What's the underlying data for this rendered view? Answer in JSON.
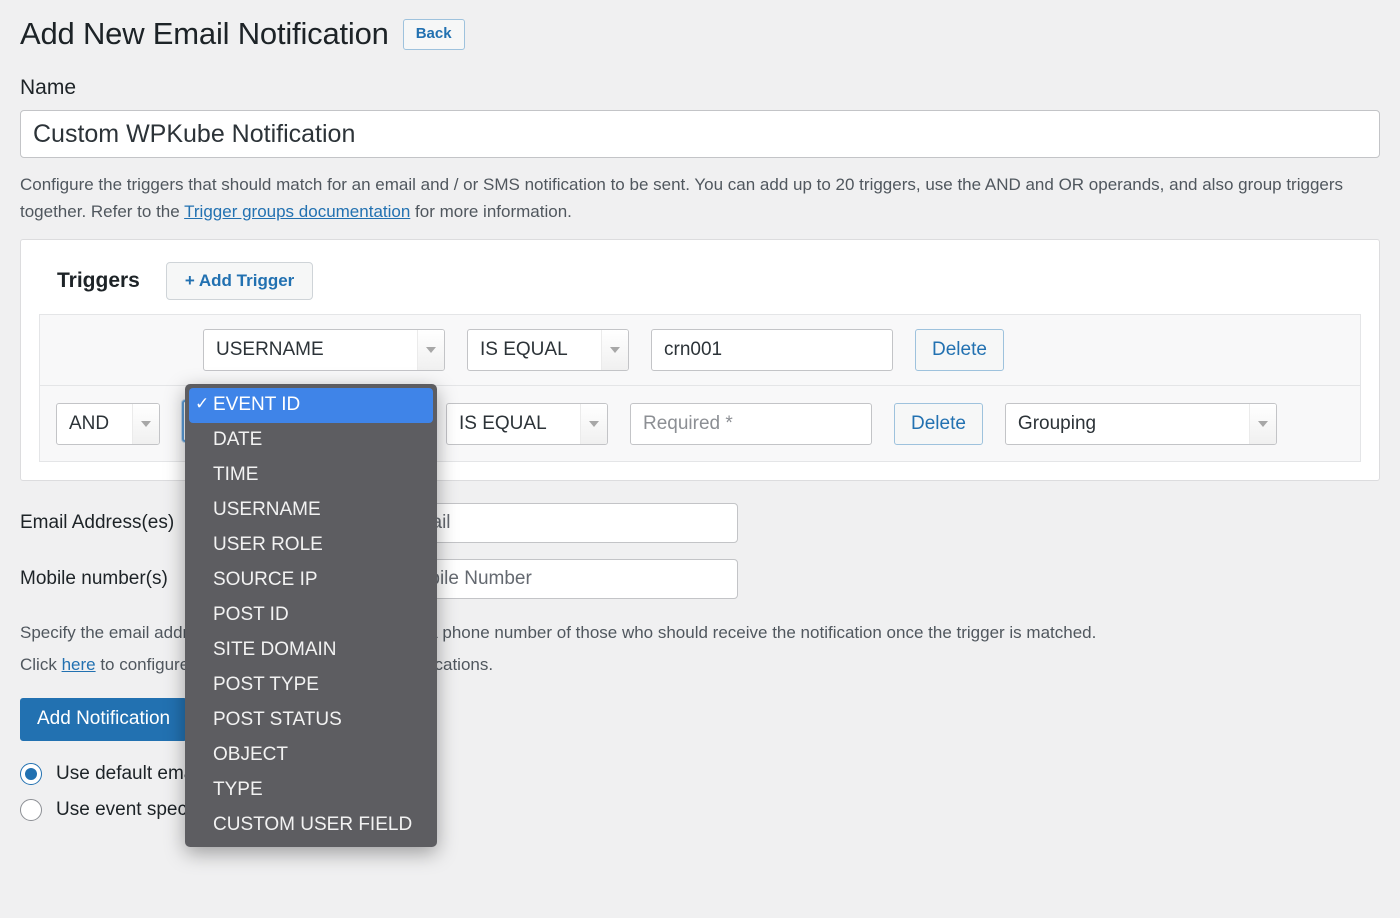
{
  "header": {
    "title": "Add New Email Notification",
    "back_label": "Back"
  },
  "name_section": {
    "label": "Name",
    "value": "Custom WPKube Notification"
  },
  "description": {
    "part1": "Configure the triggers that should match for an email and / or SMS notification to be sent. You can add up to 20 triggers, use the AND and OR operands, and also group triggers together. Refer to the ",
    "link": "Trigger groups documentation",
    "part2": " for more information."
  },
  "triggers": {
    "title": "Triggers",
    "add_label": "+ Add Trigger",
    "rows": [
      {
        "operand": "",
        "field": "USERNAME",
        "condition": "IS EQUAL",
        "value": "crn001",
        "value_placeholder": "",
        "delete_label": "Delete",
        "grouping": ""
      },
      {
        "operand": "AND",
        "field": "EVENT ID",
        "condition": "IS EQUAL",
        "value": "",
        "value_placeholder": "Required *",
        "delete_label": "Delete",
        "grouping": "Grouping"
      }
    ],
    "field_dropdown": {
      "selected": "EVENT ID",
      "options": [
        "EVENT ID",
        "DATE",
        "TIME",
        "USERNAME",
        "USER ROLE",
        "SOURCE IP",
        "POST ID",
        "SITE DOMAIN",
        "POST TYPE",
        "POST STATUS",
        "OBJECT",
        "TYPE",
        "CUSTOM USER FIELD"
      ]
    }
  },
  "recipients": {
    "email_label": "Email Address(es)",
    "email_placeholder": "Email",
    "email_value": "",
    "mobile_label": "Mobile number(s)",
    "mobile_placeholder": "Mobile Number",
    "mobile_value": ""
  },
  "notes": {
    "line1": "Specify the email address, a username, a user role or a phone number of those who should receive the notification once the trigger is matched.",
    "line2_before": "Click ",
    "line2_link": "here",
    "line2_after": " to configure the Twilio settings for SMS notifications."
  },
  "footer": {
    "submit_label": "Add Notification",
    "radio_default_label": "Use default email template",
    "radio_event_label": "Use event specific email template",
    "radio_selected": "default"
  },
  "colors": {
    "accent": "#2271b1",
    "link": "#2271b1",
    "dropdown_bg": "#5d5d61",
    "dropdown_highlight": "#3f84e8",
    "page_bg": "#f0f0f1"
  }
}
